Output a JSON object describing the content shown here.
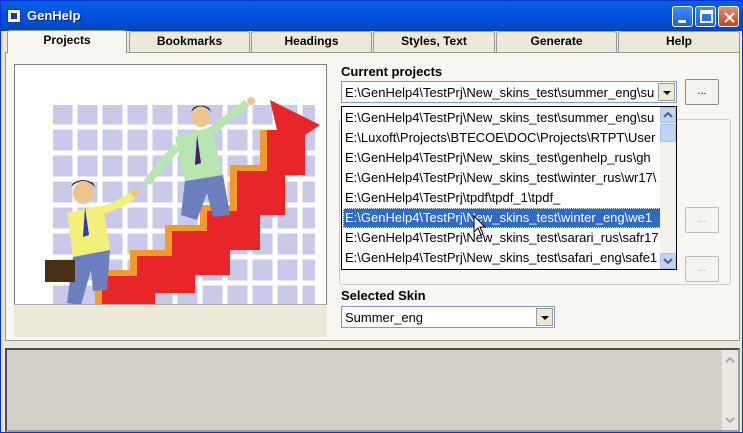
{
  "window": {
    "title": "GenHelp",
    "icon": "app-icon"
  },
  "tabs": [
    {
      "label": "Projects",
      "active": true
    },
    {
      "label": "Bookmarks",
      "active": false
    },
    {
      "label": "Headings",
      "active": false
    },
    {
      "label": "Styles, Text",
      "active": false
    },
    {
      "label": "Generate",
      "active": false
    },
    {
      "label": "Help",
      "active": false
    }
  ],
  "projects": {
    "current_label": "Current projects",
    "current_value": "E:\\GenHelp4\\TestPrj\\New_skins_test\\summer_eng\\su",
    "browse_label": "...",
    "dropdown_items": [
      "E:\\GenHelp4\\TestPrj\\New_skins_test\\summer_eng\\su",
      "E:\\Luxoft\\Projects\\BTECOE\\DOC\\Projects\\RTPT\\User",
      "E:\\GenHelp4\\TestPrj\\New_skins_test\\genhelp_rus\\gh",
      "E:\\GenHelp4\\TestPrj\\New_skins_test\\winter_rus\\wr17\\",
      "E:\\GenHelp4\\TestPrj\\tpdf\\tpdf_1\\tpdf_",
      "E:\\GenHelp4\\TestPrj\\New_skins_test\\winter_eng\\we1",
      "E:\\GenHelp4\\TestPrj\\New_skins_test\\sarari_rus\\safr17",
      "E:\\GenHelp4\\TestPrj\\New_skins_test\\safari_eng\\safe1"
    ],
    "selected_index": 5,
    "side_button_1": "...",
    "side_button_2": "...",
    "skin_label": "Selected Skin",
    "skin_value": "Summer_eng"
  },
  "colors": {
    "selection": "#316ac5",
    "titlebar": "#0054e3",
    "arrow_red": "#e8262a"
  }
}
